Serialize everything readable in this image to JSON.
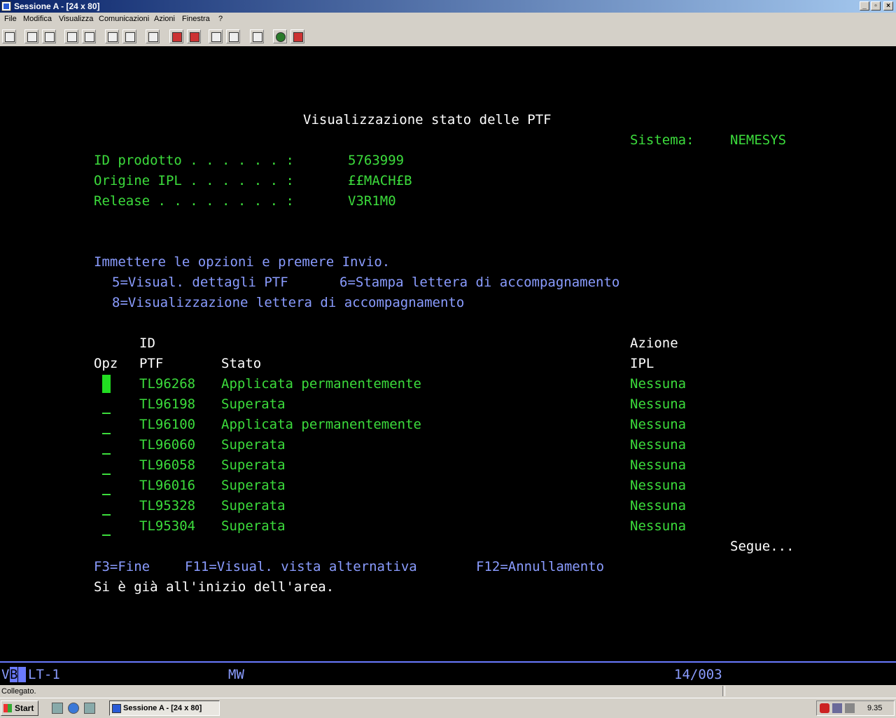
{
  "window": {
    "title": "Sessione A - [24 x 80]"
  },
  "menu": [
    "File",
    "Modifica",
    "Visualizza",
    "Comunicazioni",
    "Azioni",
    "Finestra",
    "?"
  ],
  "screen": {
    "title": "Visualizzazione stato delle PTF",
    "system_label": "Sistema:",
    "system_value": "NEMESYS",
    "fields": [
      {
        "label": "ID prodotto . . . . . . :",
        "value": "5763999"
      },
      {
        "label": "Origine IPL . . . . . . :",
        "value": "££MACH£B"
      },
      {
        "label": "Release . . . . . . . . :",
        "value": "V3R1M0"
      }
    ],
    "instructions": "Immettere le opzioni e premere Invio.",
    "options_line1a": "5=Visual. dettagli PTF",
    "options_line1b": "6=Stampa lettera di accompagnamento",
    "options_line2": "8=Visualizzazione lettera di accompagnamento",
    "headers": {
      "id_top": "ID",
      "azione_top": "Azione",
      "opz": "Opz",
      "ptf": "PTF",
      "stato": "Stato",
      "ipl": "IPL"
    },
    "rows": [
      {
        "id": "TL96268",
        "stato": "Applicata permanentemente",
        "azione": "Nessuna"
      },
      {
        "id": "TL96198",
        "stato": "Superata",
        "azione": "Nessuna"
      },
      {
        "id": "TL96100",
        "stato": "Applicata permanentemente",
        "azione": "Nessuna"
      },
      {
        "id": "TL96060",
        "stato": "Superata",
        "azione": "Nessuna"
      },
      {
        "id": "TL96058",
        "stato": "Superata",
        "azione": "Nessuna"
      },
      {
        "id": "TL96016",
        "stato": "Superata",
        "azione": "Nessuna"
      },
      {
        "id": "TL95328",
        "stato": "Superata",
        "azione": "Nessuna"
      },
      {
        "id": "TL95304",
        "stato": "Superata",
        "azione": "Nessuna"
      }
    ],
    "more": "Segue...",
    "fkeys": {
      "f3": "F3=Fine",
      "f11": "F11=Visual. vista alternativa",
      "f12": "F12=Annullamento"
    },
    "message": "Si è già all'inizio dell'area."
  },
  "oia": {
    "indicator_a": "V",
    "indicator_b": "B",
    "lt": "LT-1",
    "mw": "MW",
    "cursor_pos": "14/003"
  },
  "status": {
    "text": "Collegato."
  },
  "taskbar": {
    "start": "Start",
    "task": "Sessione A - [24 x 80]",
    "clock": "9.35"
  },
  "colors": {
    "terminal_green": "#3cdc3c",
    "terminal_blue": "#8a9cff",
    "terminal_white": "#ffffff",
    "oia_blue": "#6a7aff"
  }
}
